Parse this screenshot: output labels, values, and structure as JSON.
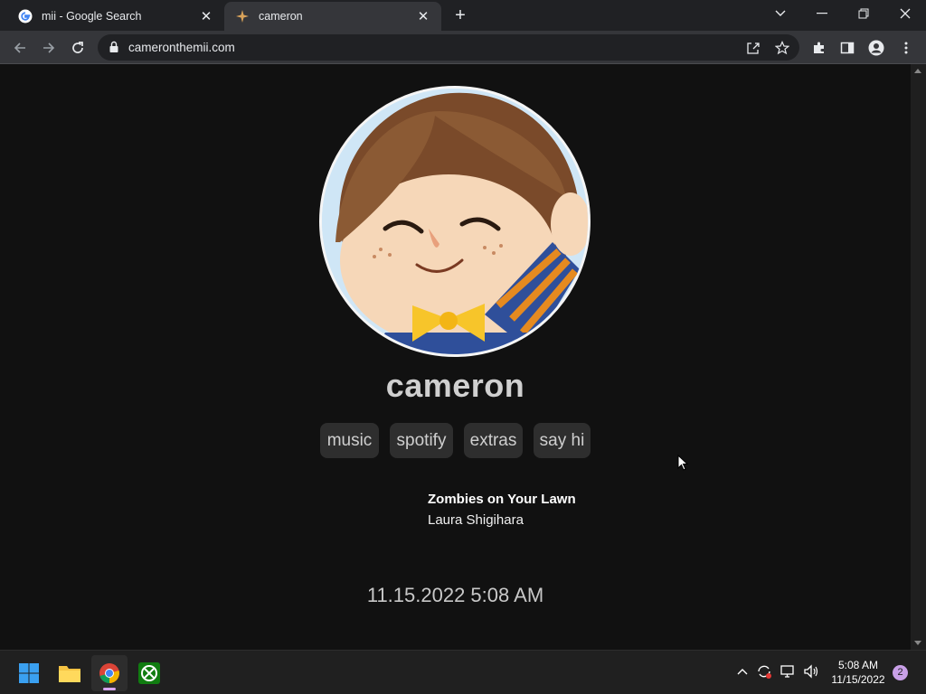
{
  "browser": {
    "tabs": [
      {
        "title": "mii - Google Search",
        "favicon": "google-g-icon",
        "active": false
      },
      {
        "title": "cameron",
        "favicon": "sparkle-icon",
        "active": true
      }
    ],
    "address": "cameronthemii.com",
    "accent": "#35363a"
  },
  "page": {
    "username": "cameron",
    "nav": [
      "music",
      "spotify",
      "extras",
      "say hi"
    ],
    "now_playing": {
      "title": "Zombies on Your Lawn",
      "artist": "Laura Shigihara"
    },
    "datetime": "11.15.2022 5:08 AM"
  },
  "taskbar": {
    "apps": [
      "windows-start-icon",
      "file-explorer-icon",
      "chrome-icon",
      "xbox-icon"
    ],
    "time": "5:08 AM",
    "date": "11/15/2022",
    "notification_count": "2"
  }
}
